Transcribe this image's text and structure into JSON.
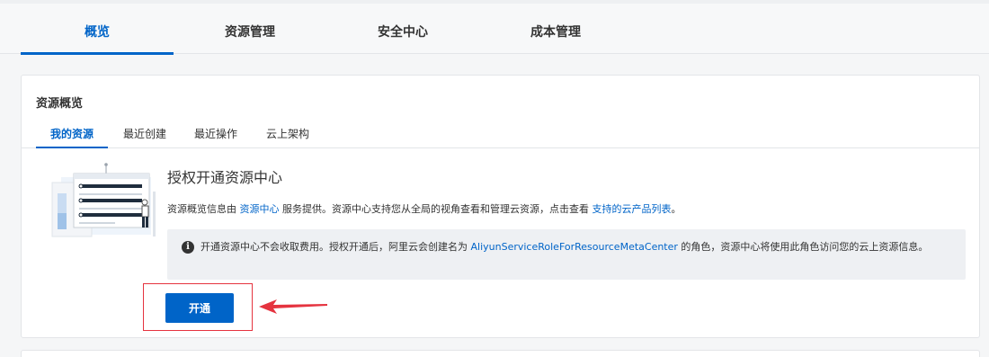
{
  "top_tabs": [
    {
      "label": "概览",
      "active": true
    },
    {
      "label": "资源管理",
      "active": false
    },
    {
      "label": "安全中心",
      "active": false
    },
    {
      "label": "成本管理",
      "active": false
    }
  ],
  "card": {
    "title": "资源概览",
    "sub_tabs": [
      {
        "label": "我的资源",
        "active": true
      },
      {
        "label": "最近创建",
        "active": false
      },
      {
        "label": "最近操作",
        "active": false
      },
      {
        "label": "云上架构",
        "active": false
      }
    ]
  },
  "auth": {
    "title": "授权开通资源中心",
    "desc_prefix": "资源概览信息由 ",
    "desc_link1": "资源中心",
    "desc_middle": " 服务提供。资源中心支持您从全局的视角查看和管理云资源，点击查看 ",
    "desc_link2": "支持的云产品列表",
    "desc_suffix": "。",
    "notice_icon": "info-icon",
    "notice_prefix": "开通资源中心不会收取费用。授权开通后，阿里云会创建名为 ",
    "notice_link": "AliyunServiceRoleForResourceMetaCenter",
    "notice_suffix": " 的角色，资源中心将使用此角色访问您的云上资源信息。",
    "button_label": "开通"
  },
  "colors": {
    "accent": "#0064c8",
    "annotation_red": "#e5333f"
  }
}
